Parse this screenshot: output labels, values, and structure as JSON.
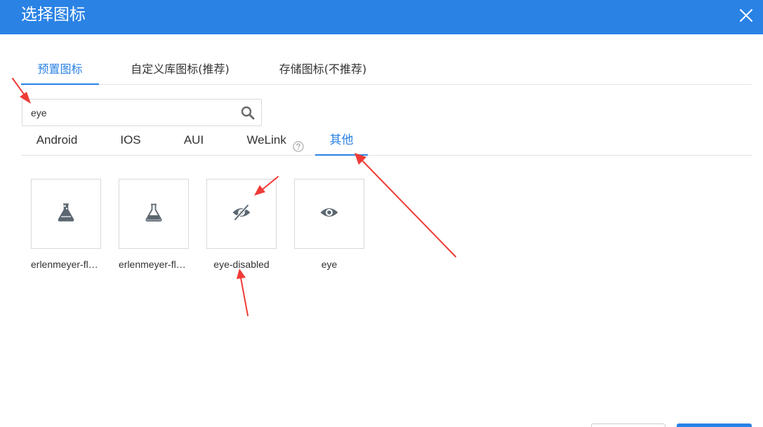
{
  "dialog": {
    "title": "选择图标",
    "close_icon": "close-icon"
  },
  "tabs": [
    {
      "label": "预置图标",
      "active": true
    },
    {
      "label": "自定义库图标(推荐)",
      "active": false
    },
    {
      "label": "存储图标(不推荐)",
      "active": false
    }
  ],
  "search": {
    "value": "eye",
    "icon": "search-icon"
  },
  "subtabs": [
    {
      "label": "Android",
      "active": false
    },
    {
      "label": "IOS",
      "active": false
    },
    {
      "label": "AUI",
      "active": false
    },
    {
      "label": "WeLink",
      "active": false,
      "help_icon": "question-circle-icon"
    },
    {
      "label": "其他",
      "active": true
    }
  ],
  "icons": [
    {
      "label": "erlenmeyer-flask-bubbles",
      "icon": "erlenmeyer-flask-bubbles-icon"
    },
    {
      "label": "erlenmeyer-flask",
      "icon": "erlenmeyer-flask-icon"
    },
    {
      "label": "eye-disabled",
      "icon": "eye-disabled-icon"
    },
    {
      "label": "eye",
      "icon": "eye-icon"
    }
  ],
  "colors": {
    "primary": "#2a82e4",
    "annotation_arrow": "#ef3b36",
    "icon_gray": "#5b6670",
    "border": "#d9d9d9"
  }
}
